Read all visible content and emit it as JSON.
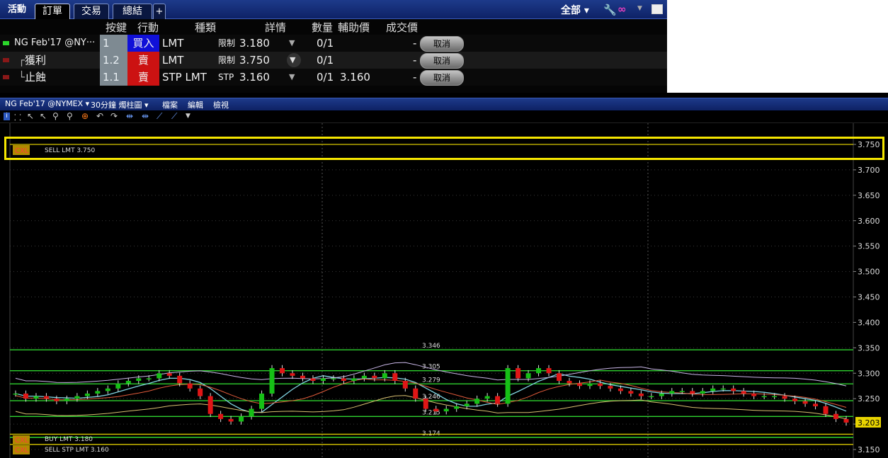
{
  "tabs": {
    "activity": "活動",
    "orders": "訂單",
    "trades": "交易",
    "summary": "總結",
    "add": "+"
  },
  "filter": "全部 ▾",
  "headers": {
    "key": "按鍵",
    "action": "行動",
    "type": "種類",
    "details": "詳情",
    "quantity": "數量",
    "aux_price": "輔助價",
    "fill_price": "成交價"
  },
  "orders": [
    {
      "name": "NG Feb'17 @NY···",
      "key": "1",
      "action": "買入",
      "type": "LMT",
      "details_prefix": "限制",
      "details_price": "3.180",
      "quantity": "0/1",
      "aux_price": "",
      "fill_price": "-",
      "cancel": "取消",
      "side": "buy"
    },
    {
      "name": "獲利",
      "key": "1.2",
      "action": "賣",
      "type": "LMT",
      "details_prefix": "限制",
      "details_price": "3.750",
      "quantity": "0/1",
      "aux_price": "",
      "fill_price": "-",
      "cancel": "取消",
      "side": "sell"
    },
    {
      "name": "止蝕",
      "key": "1.1",
      "action": "賣",
      "type": "STP LMT",
      "details_prefix": "STP",
      "details_price": "3.160",
      "quantity": "0/1",
      "aux_price": "3.160",
      "fill_price": "-",
      "cancel": "取消",
      "side": "sell"
    }
  ],
  "chart_window": {
    "symbol": "NG Feb'17 @NYMEX ▾",
    "period": "30分鐘 燭柱圖 ▾",
    "menu_file": "檔案",
    "menu_edit": "編輯",
    "menu_view": "檢視"
  },
  "chart_overlays": {
    "top_cxl": "CXL",
    "top_order": "SELL LMT 3.750",
    "buy_cxl": "CXL",
    "buy_order": "BUY LMT 3.180",
    "stp_cxl": "CXL",
    "stp_order": "SELL STP LMT 3.160",
    "current_price": "3.203"
  },
  "chart_data": {
    "type": "candlestick",
    "ylim": [
      3.14,
      3.775
    ],
    "y_ticks": [
      "3.750",
      "3.700",
      "3.650",
      "3.600",
      "3.550",
      "3.500",
      "3.450",
      "3.400",
      "3.350",
      "3.300",
      "3.250",
      "3.200",
      "3.150"
    ],
    "level_labels": [
      "3.346",
      "3.305",
      "3.279",
      "3.246",
      "3.215",
      "3.174"
    ],
    "order_lines": [
      3.75,
      3.18,
      3.16
    ],
    "last_price": 3.203,
    "colors": {
      "up": "#16c016",
      "down": "#e01616",
      "order_line": "#d8c800",
      "level": "#2fd22f",
      "grid": "#3a3a3a"
    }
  }
}
